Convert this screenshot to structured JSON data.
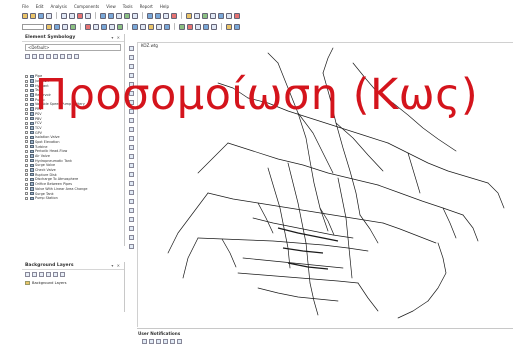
{
  "menu": [
    "File",
    "Edit",
    "Analysis",
    "Components",
    "View",
    "Tools",
    "Report",
    "Help"
  ],
  "element_symbology": {
    "title": "Element Symbology",
    "combo_value": "&lt;Default&gt;",
    "items": [
      "Pipe",
      "Junction",
      "Hydrant",
      "Tank",
      "Reservoir",
      "Pump",
      "Variable Speed Pump Battery",
      "PRV",
      "PSV",
      "PBV",
      "FCV",
      "TCV",
      "GPV",
      "Isolation Valve",
      "Spot Elevation",
      "Turbine",
      "Periodic Head-Flow",
      "Air Valve",
      "Hydropneumatic Tank",
      "Surge Valve",
      "Check Valve",
      "Rupture Disk",
      "Discharge To Atmosphere",
      "Orifice Between Pipes",
      "Valve With Linear Area Change",
      "Surge Tank",
      "Pump Station"
    ]
  },
  "background_layers": {
    "title": "Background Layers",
    "item": "Background Layers"
  },
  "map": {
    "tab": "KOZ.wtg"
  },
  "notifications": {
    "title": "User Notifications"
  },
  "overlay_title": "Προσομοίωση (Κως)",
  "colors": {
    "overlay": "#d4141c",
    "network": "#1a1a1a"
  }
}
